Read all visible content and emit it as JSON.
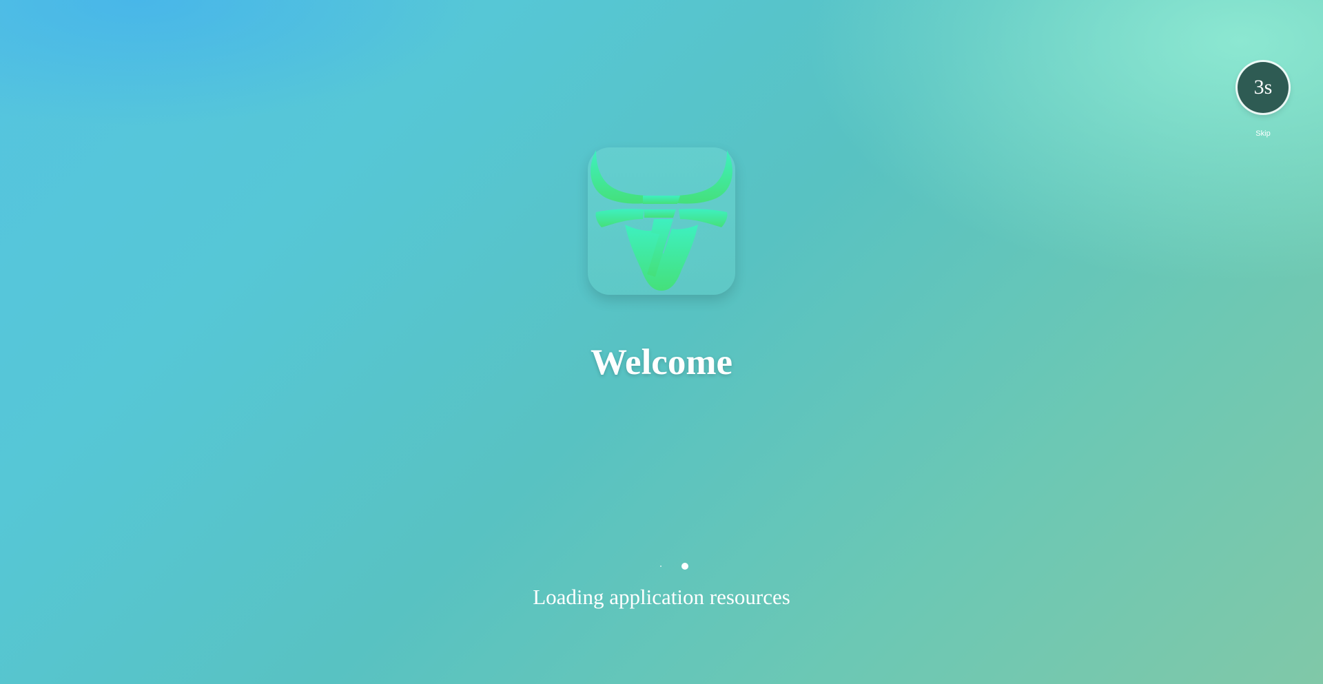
{
  "countdown": {
    "label": "3s",
    "skip_label": "Skip"
  },
  "logo": {
    "icon": "bull-rupee-icon",
    "color_top": "#3ef0c0",
    "color_bottom": "#45e07a"
  },
  "welcome": {
    "title": "Welcome"
  },
  "loading": {
    "text": "Loading application resources",
    "indicator_total": 2,
    "indicator_active": 2
  },
  "colors": {
    "background_start": "#55c4e0",
    "background_end": "#80c8a8",
    "countdown_bg": "#2e5b53",
    "text": "#ffffff"
  }
}
